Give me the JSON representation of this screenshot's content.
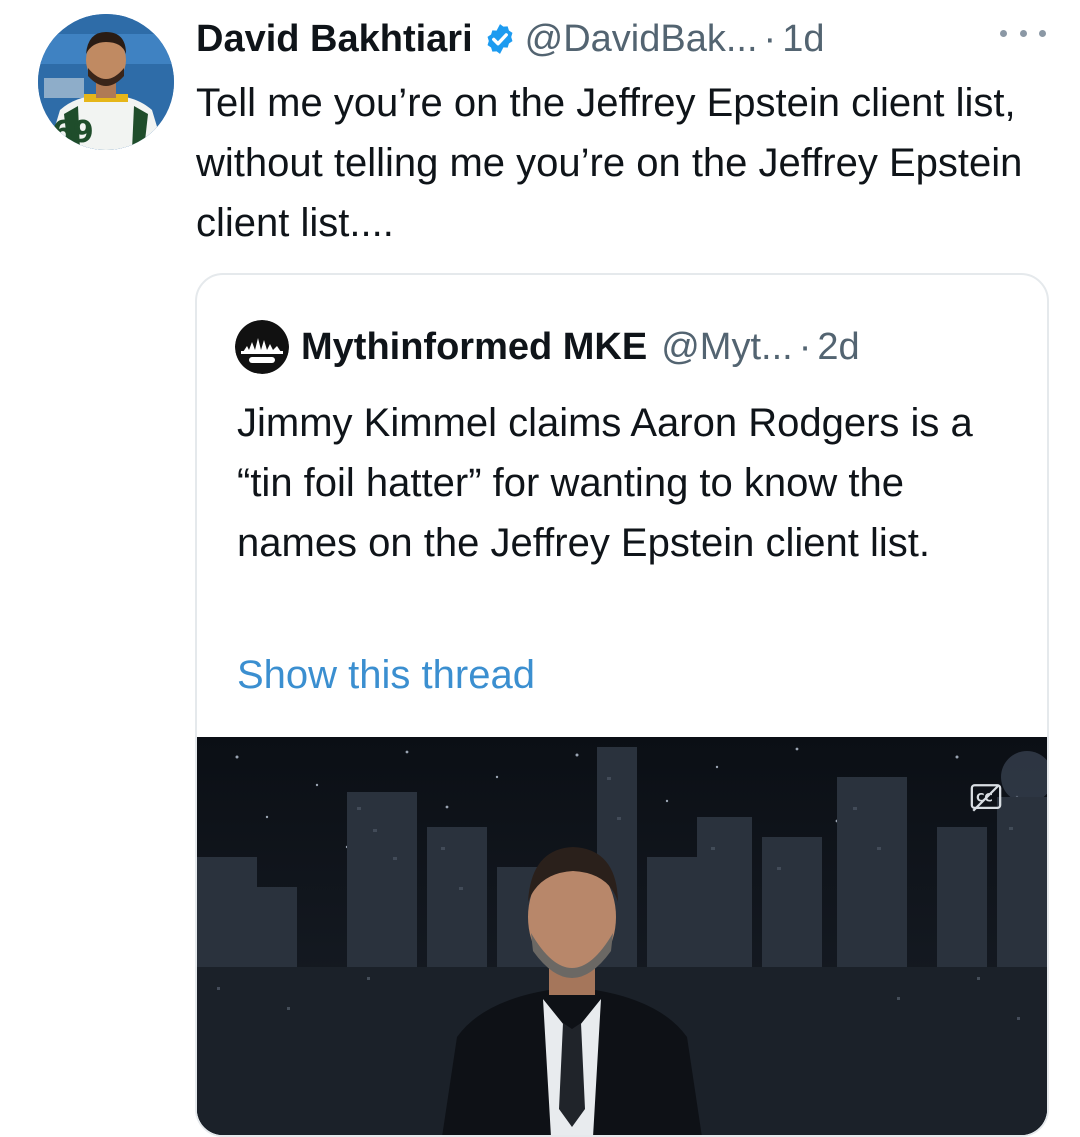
{
  "post": {
    "author_name": "David Bakhtiari",
    "handle": "@DavidBak...",
    "separator": "·",
    "time": "1d",
    "text": "Tell me you’re on the Jeffrey Epstein client list, without telling me you’re on the Jeffrey Epstein client list....",
    "avatar_jersey_number": "69",
    "icons": {
      "verified": "verified-badge-icon",
      "more": "more-options-icon"
    }
  },
  "quoted_post": {
    "author_name": "Mythinformed MKE",
    "handle": "@Myt...",
    "separator": "·",
    "time": "2d",
    "text": "Jimmy Kimmel claims Aaron Rodgers is a “tin foil hatter” for wanting to know the names on the Jeffrey Epstein client list.",
    "show_thread": "Show this thread",
    "media": {
      "kind": "video-thumbnail",
      "icons": {
        "captions": "closed-captions-icon"
      }
    }
  },
  "colors": {
    "text_primary": "#0f1419",
    "text_secondary": "#536471",
    "link": "#3b8fd0",
    "verified": "#1d9bf0",
    "border": "#e5e9ec"
  }
}
